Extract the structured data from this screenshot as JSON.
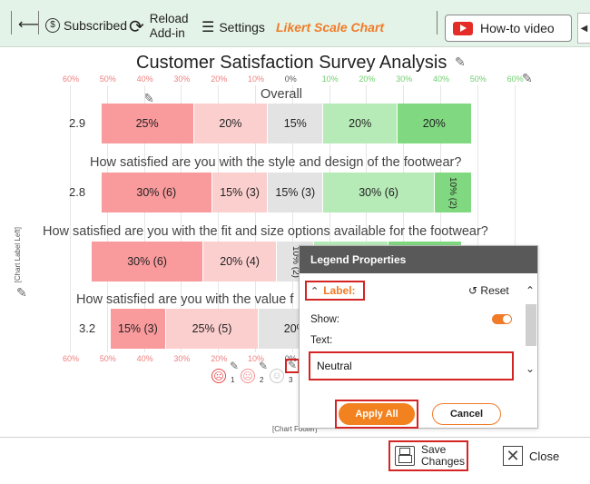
{
  "toolbar": {
    "subscribed_label": "Subscribed",
    "reload_label": "Reload\nAdd-in",
    "settings_label": "Settings",
    "title": "Likert Scale Chart",
    "howto_label": "How-to video"
  },
  "chart_data": {
    "type": "bar",
    "title": "Customer Satisfaction Survey Analysis",
    "axis_ticks_top": [
      "60%",
      "50%",
      "40%",
      "30%",
      "20%",
      "10%",
      "0%",
      "10%",
      "20%",
      "30%",
      "40%",
      "50%",
      "60%"
    ],
    "axis_ticks_bottom": [
      "60%",
      "50%",
      "40%",
      "30%",
      "20%",
      "10%",
      "0%"
    ],
    "rows": [
      {
        "question": "Overall",
        "mean": "2.9",
        "segments": [
          {
            "category": 1,
            "value": 25,
            "label": "25%"
          },
          {
            "category": 2,
            "value": 20,
            "label": "20%"
          },
          {
            "category": 3,
            "value": 15,
            "label": "15%"
          },
          {
            "category": 4,
            "value": 20,
            "label": "20%"
          },
          {
            "category": 5,
            "value": 20,
            "label": "20%"
          }
        ]
      },
      {
        "question": "How satisfied are you with the style and design of the footwear?",
        "mean": "2.8",
        "segments": [
          {
            "category": 1,
            "value": 30,
            "label": "30% (6)"
          },
          {
            "category": 2,
            "value": 15,
            "label": "15% (3)"
          },
          {
            "category": 3,
            "value": 15,
            "label": "15% (3)"
          },
          {
            "category": 4,
            "value": 30,
            "label": "30% (6)"
          },
          {
            "category": 5,
            "value": 10,
            "label": "10% (2)"
          }
        ]
      },
      {
        "question": "How satisfied are you with the fit and size options available for the footwear?",
        "mean": "",
        "segments": [
          {
            "category": 1,
            "value": 30,
            "label": "30% (6)"
          },
          {
            "category": 2,
            "value": 20,
            "label": "20% (4)"
          },
          {
            "category": 3,
            "value": 10,
            "label": "10% (2)"
          },
          {
            "category": 4,
            "value": 20,
            "label": ""
          },
          {
            "category": 5,
            "value": 20,
            "label": ""
          }
        ]
      },
      {
        "question": "How satisfied are you with the value f",
        "mean": "3.2",
        "segments": [
          {
            "category": 1,
            "value": 15,
            "label": "15% (3)"
          },
          {
            "category": 2,
            "value": 25,
            "label": "25% (5)"
          },
          {
            "category": 3,
            "value": 20,
            "label": "20%"
          }
        ]
      }
    ],
    "colors": [
      "#f99a9c",
      "#fccfcf",
      "#e3e3e3",
      "#b6eab6",
      "#80d980"
    ],
    "legend_numbers": [
      "1",
      "2",
      "3"
    ]
  },
  "chart_labels": {
    "left": "[Chart Label Left]",
    "footer": "[Chart Footer]"
  },
  "panel": {
    "title": "Legend Properties",
    "section_label": "Label:",
    "reset_label": "Reset",
    "show_label": "Show:",
    "text_label": "Text:",
    "text_value": "Neutral",
    "apply_label": "Apply All",
    "cancel_label": "Cancel"
  },
  "footer": {
    "save_label": "Save\nChanges",
    "close_label": "Close"
  }
}
